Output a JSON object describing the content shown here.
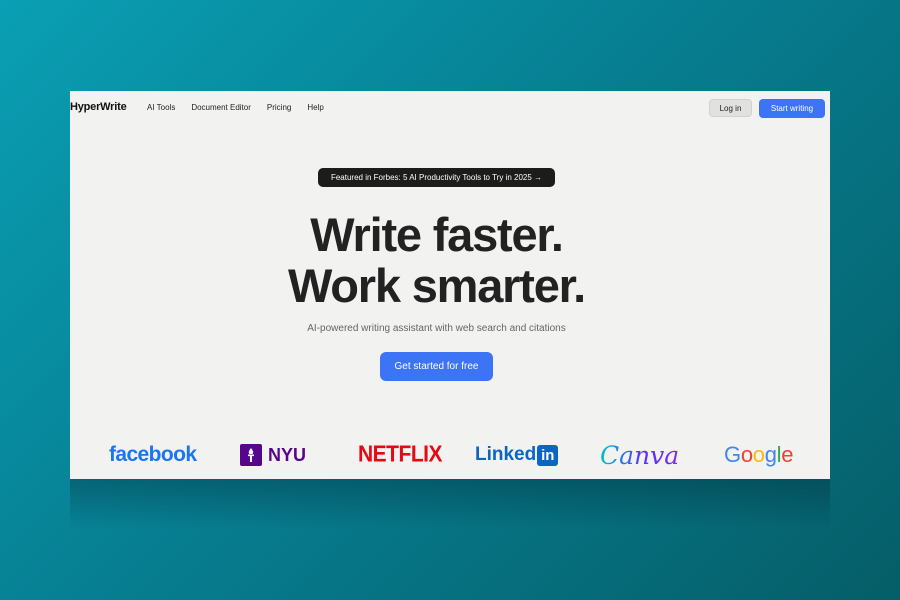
{
  "nav": {
    "brand": "HyperWrite",
    "links": [
      "AI Tools",
      "Document Editor",
      "Pricing",
      "Help"
    ],
    "login_label": "Log in",
    "start_label": "Start writing"
  },
  "hero": {
    "badge": "Featured in Forbes: 5 AI Productivity Tools to Try in 2025 →",
    "headline_line1": "Write faster.",
    "headline_line2": "Work smarter.",
    "subline": "AI-powered writing assistant with web search and citations",
    "cta_label": "Get started for free"
  },
  "logos": {
    "facebook": "facebook",
    "nyu": "NYU",
    "netflix": "NETFLIX",
    "linkedin_text": "Linked",
    "linkedin_box": "in",
    "canva": "Canva",
    "google": [
      "G",
      "o",
      "o",
      "g",
      "l",
      "e"
    ]
  },
  "colors": {
    "accent_blue": "#3d73f5",
    "page_bg": "#f2f2f0",
    "google": [
      "#4285f4",
      "#ea4335",
      "#fbbc05",
      "#4285f4",
      "#34a853",
      "#ea4335"
    ]
  }
}
